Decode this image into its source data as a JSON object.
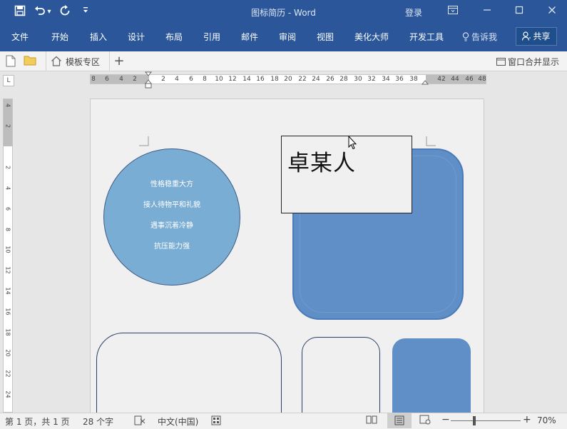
{
  "titlebar": {
    "document_title": "图标简历 - Word",
    "login_label": "登录",
    "quick_access": {
      "save_icon": "save-icon",
      "undo_icon": "undo-icon",
      "undo_dropdown": "▾",
      "redo_icon": "redo-icon",
      "customize_icon": "customize-icon"
    },
    "window_buttons": [
      "ribbon-display-options",
      "minimize",
      "maximize",
      "close"
    ]
  },
  "ribbon": {
    "tabs": [
      "文件",
      "开始",
      "插入",
      "设计",
      "布局",
      "引用",
      "邮件",
      "审阅",
      "视图",
      "美化大师",
      "开发工具"
    ],
    "tell_me": "告诉我",
    "share": "共享"
  },
  "tabbar": {
    "template_label": "模板专区",
    "plus_label": "+",
    "merge_window_label": "窗口合并显示"
  },
  "ruler": {
    "corner_label": "L",
    "horizontal_numbers": [
      "8",
      "6",
      "4",
      "2",
      "2",
      "4",
      "6",
      "8",
      "10",
      "12",
      "14",
      "16",
      "18",
      "20",
      "22",
      "24",
      "26",
      "28",
      "30",
      "32",
      "34",
      "36",
      "38",
      "42",
      "44",
      "46",
      "48"
    ],
    "vertical_numbers": [
      "4",
      "2",
      "2",
      "4",
      "6",
      "8",
      "10",
      "12",
      "14",
      "16",
      "18",
      "20",
      "22",
      "24"
    ]
  },
  "document": {
    "traits": [
      "性格稳重大方",
      "接人待物平和礼貌",
      "遇事沉着冷静",
      "抗压能力强"
    ],
    "name": "卓某人",
    "colors": {
      "circle_fill": "#7aadd3",
      "shape_blue": "#5f8fc6",
      "outline": "#2d3e66"
    }
  },
  "statusbar": {
    "page_info": "第 1 页，共 1 页",
    "word_count": "28 个字",
    "language": "中文(中国)",
    "zoom_minus": "−",
    "zoom_plus": "+",
    "zoom_level": "70%"
  }
}
